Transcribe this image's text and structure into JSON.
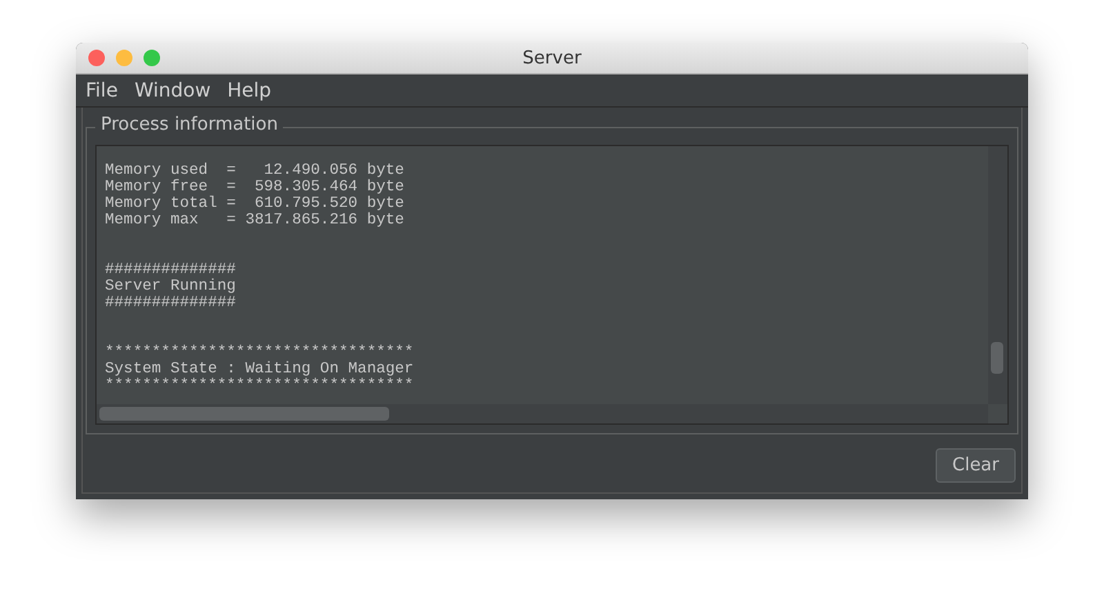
{
  "window": {
    "title": "Server"
  },
  "menu": [
    "File",
    "Window",
    "Help"
  ],
  "panel": {
    "title": "Process information"
  },
  "log_blocks": [
    [
      "Memory used  =   12.490.056 byte",
      "Memory free  =  598.305.464 byte",
      "Memory total =  610.795.520 byte",
      "Memory max   = 3817.865.216 byte"
    ],
    [
      "##############",
      "Server Running",
      "##############"
    ],
    [
      "*********************************",
      "System State : Waiting On Manager",
      "*********************************"
    ]
  ],
  "buttons": [
    "Clear"
  ]
}
